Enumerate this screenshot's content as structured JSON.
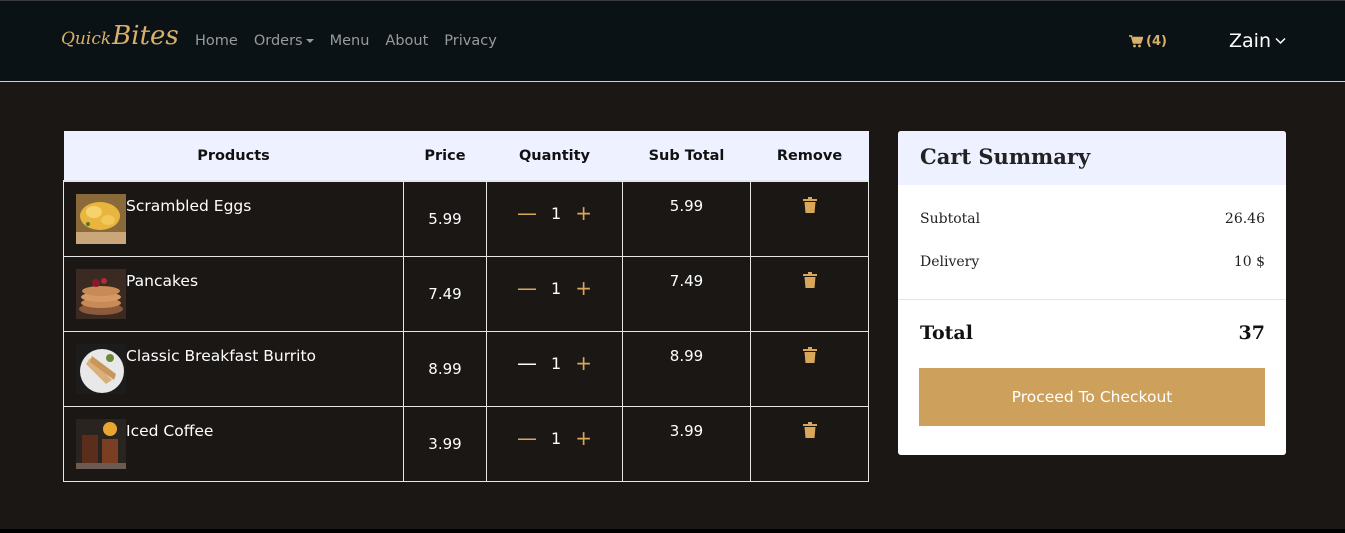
{
  "brand": {
    "prefix": "Quick",
    "main": "Bites"
  },
  "nav": {
    "home": "Home",
    "orders": "Orders",
    "menu": "Menu",
    "about": "About",
    "privacy": "Privacy"
  },
  "cart": {
    "count_label": "(4)"
  },
  "user": {
    "name": "Zain"
  },
  "table": {
    "headers": [
      "Products",
      "Price",
      "Quantity",
      "Sub Total",
      "Remove"
    ],
    "rows": [
      {
        "name": "Scrambled Eggs",
        "price": "5.99",
        "qty": "1",
        "subtotal": "5.99"
      },
      {
        "name": "Pancakes",
        "price": "7.49",
        "qty": "1",
        "subtotal": "7.49"
      },
      {
        "name": "Classic Breakfast Burrito",
        "price": "8.99",
        "qty": "1",
        "subtotal": "8.99"
      },
      {
        "name": "Iced Coffee",
        "price": "3.99",
        "qty": "1",
        "subtotal": "3.99"
      }
    ]
  },
  "summary": {
    "title": "Cart Summary",
    "subtotal_label": "Subtotal",
    "subtotal_value": "26.46",
    "delivery_label": "Delivery",
    "delivery_value": "10 $",
    "total_label": "Total",
    "total_value": "37",
    "checkout_label": "Proceed To Checkout"
  },
  "colors": {
    "accent": "#cda15c",
    "nav_bg": "#0b1215",
    "page_bg": "#1a1715",
    "header_bg": "#eef1ff"
  },
  "icons": [
    "cart-icon",
    "chevron-down-icon",
    "minus-icon",
    "plus-icon",
    "trash-icon"
  ]
}
